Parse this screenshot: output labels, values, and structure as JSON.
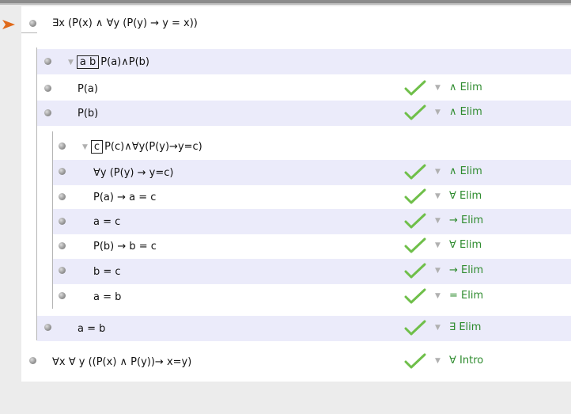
{
  "premise": "∃x (P(x) ∧ ∀y (P(y) → y = x))",
  "subproof_a": {
    "boxed": "a b",
    "assumption": "P(a)∧P(b)",
    "lines": [
      {
        "formula": "P(a)",
        "rule": "∧ Elim"
      },
      {
        "formula": "P(b)",
        "rule": "∧ Elim"
      }
    ]
  },
  "subproof_c": {
    "boxed": "c",
    "assumption": "P(c)∧∀y(P(y)→y=c)",
    "lines": [
      {
        "formula": "∀y (P(y) → y=c)",
        "rule": "∧ Elim"
      },
      {
        "formula": "P(a) → a = c",
        "rule": "∀ Elim"
      },
      {
        "formula": "a = c",
        "rule": "→ Elim"
      },
      {
        "formula": "P(b) → b = c",
        "rule": "∀ Elim"
      },
      {
        "formula": "b = c",
        "rule": "→ Elim"
      },
      {
        "formula": "a = b",
        "rule": "= Elim"
      }
    ]
  },
  "after_c": {
    "formula": "a = b",
    "rule": "∃ Elim"
  },
  "conclusion": {
    "formula": "∀x ∀ y ((P(x) ∧ P(y))→ x=y)",
    "rule": "∀ Intro"
  },
  "colors": {
    "check": "#6fbf4a",
    "rule": "#2e8b2e",
    "stripe": "#ebebfa",
    "marker": "#e06a1a"
  }
}
